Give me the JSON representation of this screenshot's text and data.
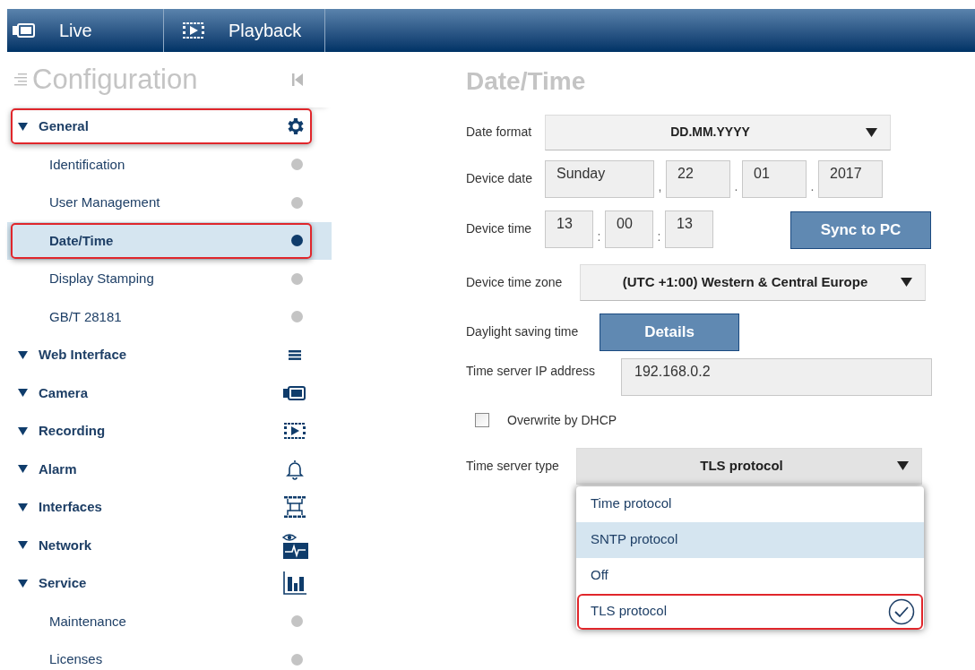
{
  "top_tabs": [
    {
      "label": "Live",
      "selected": false
    },
    {
      "label": "Playback",
      "selected": false
    }
  ],
  "sidebar": {
    "title": "Configuration",
    "items": [
      {
        "label": "General",
        "highlighted": true,
        "children": [
          {
            "label": "Identification",
            "selected": false,
            "highlighted": false
          },
          {
            "label": "User Management",
            "selected": false,
            "highlighted": false
          },
          {
            "label": "Date/Time",
            "selected": true,
            "highlighted": true
          },
          {
            "label": "Display Stamping",
            "selected": false,
            "highlighted": false
          },
          {
            "label": "GB/T 28181",
            "selected": false,
            "highlighted": false
          }
        ]
      },
      {
        "label": "Web Interface",
        "highlighted": false
      },
      {
        "label": "Camera",
        "highlighted": false
      },
      {
        "label": "Recording",
        "highlighted": false
      },
      {
        "label": "Alarm",
        "highlighted": false
      },
      {
        "label": "Interfaces",
        "highlighted": false
      },
      {
        "label": "Network",
        "highlighted": false
      },
      {
        "label": "Service",
        "highlighted": false,
        "children": [
          {
            "label": "Maintenance",
            "selected": false,
            "highlighted": false
          },
          {
            "label": "Licenses",
            "selected": false,
            "highlighted": false
          }
        ]
      }
    ]
  },
  "page": {
    "title": "Date/Time",
    "date_format": {
      "label": "Date format",
      "value": "DD.MM.YYYY"
    },
    "device_date": {
      "label": "Device date",
      "weekday": "Sunday",
      "sep1": ",",
      "day": "22",
      "sep2": ".",
      "month": "01",
      "sep3": ".",
      "year": "2017"
    },
    "device_time": {
      "label": "Device time",
      "hour": "13",
      "sep1": ":",
      "minute": "00",
      "sep2": ":",
      "second": "13",
      "button": "Sync to PC"
    },
    "time_zone": {
      "label": "Device time zone",
      "value": "(UTC +1:00) Western & Central Europe"
    },
    "daylight": {
      "label": "Daylight saving time",
      "button": "Details"
    },
    "server_ip": {
      "label": "Time server IP address",
      "value": "192.168.0.2"
    },
    "dhcp": {
      "label": "Overwrite by DHCP",
      "checked": false
    },
    "server_type": {
      "label": "Time server type",
      "value": "TLS protocol",
      "expanded": true,
      "options": [
        {
          "label": "Time protocol",
          "selected": false,
          "hovered": false,
          "highlighted": false
        },
        {
          "label": "SNTP protocol",
          "selected": false,
          "hovered": true,
          "highlighted": false
        },
        {
          "label": "Off",
          "selected": false,
          "hovered": false,
          "highlighted": false
        },
        {
          "label": "TLS protocol",
          "selected": true,
          "hovered": false,
          "highlighted": true
        }
      ]
    }
  }
}
